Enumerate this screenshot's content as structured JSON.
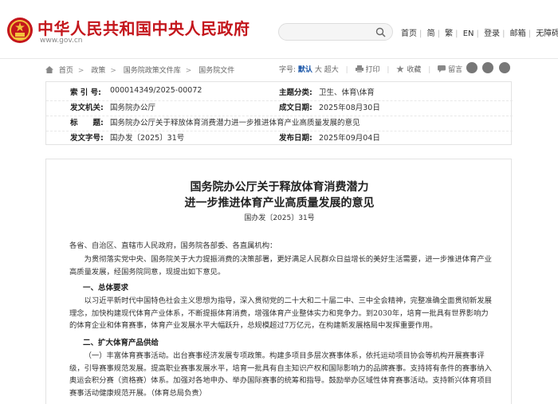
{
  "header": {
    "site_title": "中华人民共和国中央人民政府",
    "site_url": "www.gov.cn",
    "nav": [
      "首页",
      "简",
      "繁",
      "EN",
      "登录",
      "邮箱",
      "无障碍"
    ]
  },
  "breadcrumb": {
    "items": [
      "首页",
      "政策",
      "国务院政策文件库",
      "国务院文件"
    ]
  },
  "tools": {
    "font_label": "字号:",
    "font_sizes": [
      "默认",
      "大",
      "超大"
    ],
    "print": "打印",
    "favorite": "收藏",
    "comment": "留言"
  },
  "info": {
    "index_label": "索 引 号:",
    "index_value": "000014349/2025-00072",
    "category_label": "主题分类:",
    "category_value": "卫生、体育\\体育",
    "issuer_label": "发文机关:",
    "issuer_value": "国务院办公厅",
    "date_label": "成文日期:",
    "date_value": "2025年08月30日",
    "title_label": "标　　题:",
    "title_value": "国务院办公厅关于释放体育消费潜力进一步推进体育产业高质量发展的意见",
    "docno_label": "发文字号:",
    "docno_value": "国办发〔2025〕31号",
    "publish_label": "发布日期:",
    "publish_value": "2025年09月04日"
  },
  "article": {
    "title_line1": "国务院办公厅关于释放体育消费潜力",
    "title_line2": "进一步推进体育产业高质量发展的意见",
    "doc_no": "国办发〔2025〕31号",
    "salutation": "各省、自治区、直辖市人民政府，国务院各部委、各直属机构：",
    "intro": "为贯彻落实党中央、国务院关于大力提振消费的决策部署，更好满足人民群众日益增长的美好生活需要，进一步推进体育产业高质量发展，经国务院同意，现提出如下意见。",
    "h1": "一、总体要求",
    "p1": "以习近平新时代中国特色社会主义思想为指导，深入贯彻党的二十大和二十届二中、三中全会精神，完整准确全面贯彻新发展理念，加快构建现代体育产业体系，不断提振体育消费，增强体育产业整体实力和竞争力。到2030年，培育一批具有世界影响力的体育企业和体育赛事，体育产业发展水平大幅跃升，总规模超过7万亿元，在构建新发展格局中发挥重要作用。",
    "h2": "二、扩大体育产品供给",
    "p2": "（一）丰富体育赛事活动。出台赛事经济发展专项政策。构建多项目多层次赛事体系，依托运动项目协会等机构开展赛事评级，引导赛事规范发展。提高职业赛事发展水平，培育一批具有自主知识产权和国际影响力的品牌赛事。支持将有条件的赛事纳入奥运会积分赛（资格赛）体系。加强对各地申办、举办国际赛事的统筹和指导。鼓励举办区域性体育赛事活动。支持新兴体育项目赛事活动健康规范开展。（体育总局负责）"
  },
  "colors": {
    "brand_red": "#c4161c",
    "link_blue": "#1a56a8"
  }
}
